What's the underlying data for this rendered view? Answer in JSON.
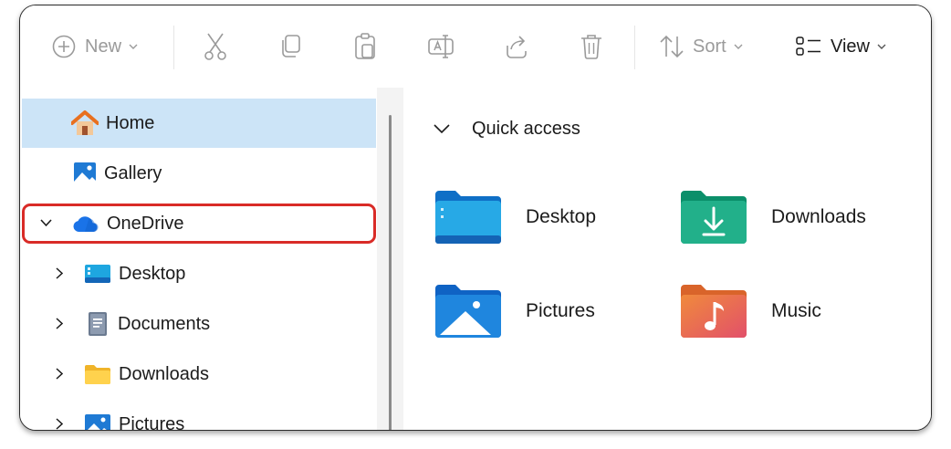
{
  "toolbar": {
    "new_label": "New",
    "sort_label": "Sort",
    "view_label": "View",
    "icons": [
      "add-circle-icon",
      "cut-icon",
      "copy-icon",
      "paste-icon",
      "rename-icon",
      "share-icon",
      "delete-icon",
      "sort-icon",
      "view-icon"
    ]
  },
  "nav": {
    "items": [
      {
        "label": "Home",
        "icon": "home-icon"
      },
      {
        "label": "Gallery",
        "icon": "gallery-icon"
      },
      {
        "label": "OneDrive",
        "icon": "onedrive-cloud-icon"
      },
      {
        "label": "Desktop",
        "icon": "desktop-folder-icon"
      },
      {
        "label": "Documents",
        "icon": "documents-icon"
      },
      {
        "label": "Downloads",
        "icon": "downloads-folder-icon"
      },
      {
        "label": "Pictures",
        "icon": "pictures-folder-icon"
      }
    ]
  },
  "quick_access": {
    "title": "Quick access",
    "items": [
      {
        "label": "Desktop",
        "icon": "desktop-folder-icon"
      },
      {
        "label": "Downloads",
        "icon": "downloads-folder-icon"
      },
      {
        "label": "Pictures",
        "icon": "pictures-folder-icon"
      },
      {
        "label": "Music",
        "icon": "music-folder-icon"
      }
    ]
  },
  "colors": {
    "selection": "#cce4f7",
    "highlight_border": "#d92b27",
    "home_roof": "#e8701f",
    "onedrive": "#1a73e8"
  }
}
